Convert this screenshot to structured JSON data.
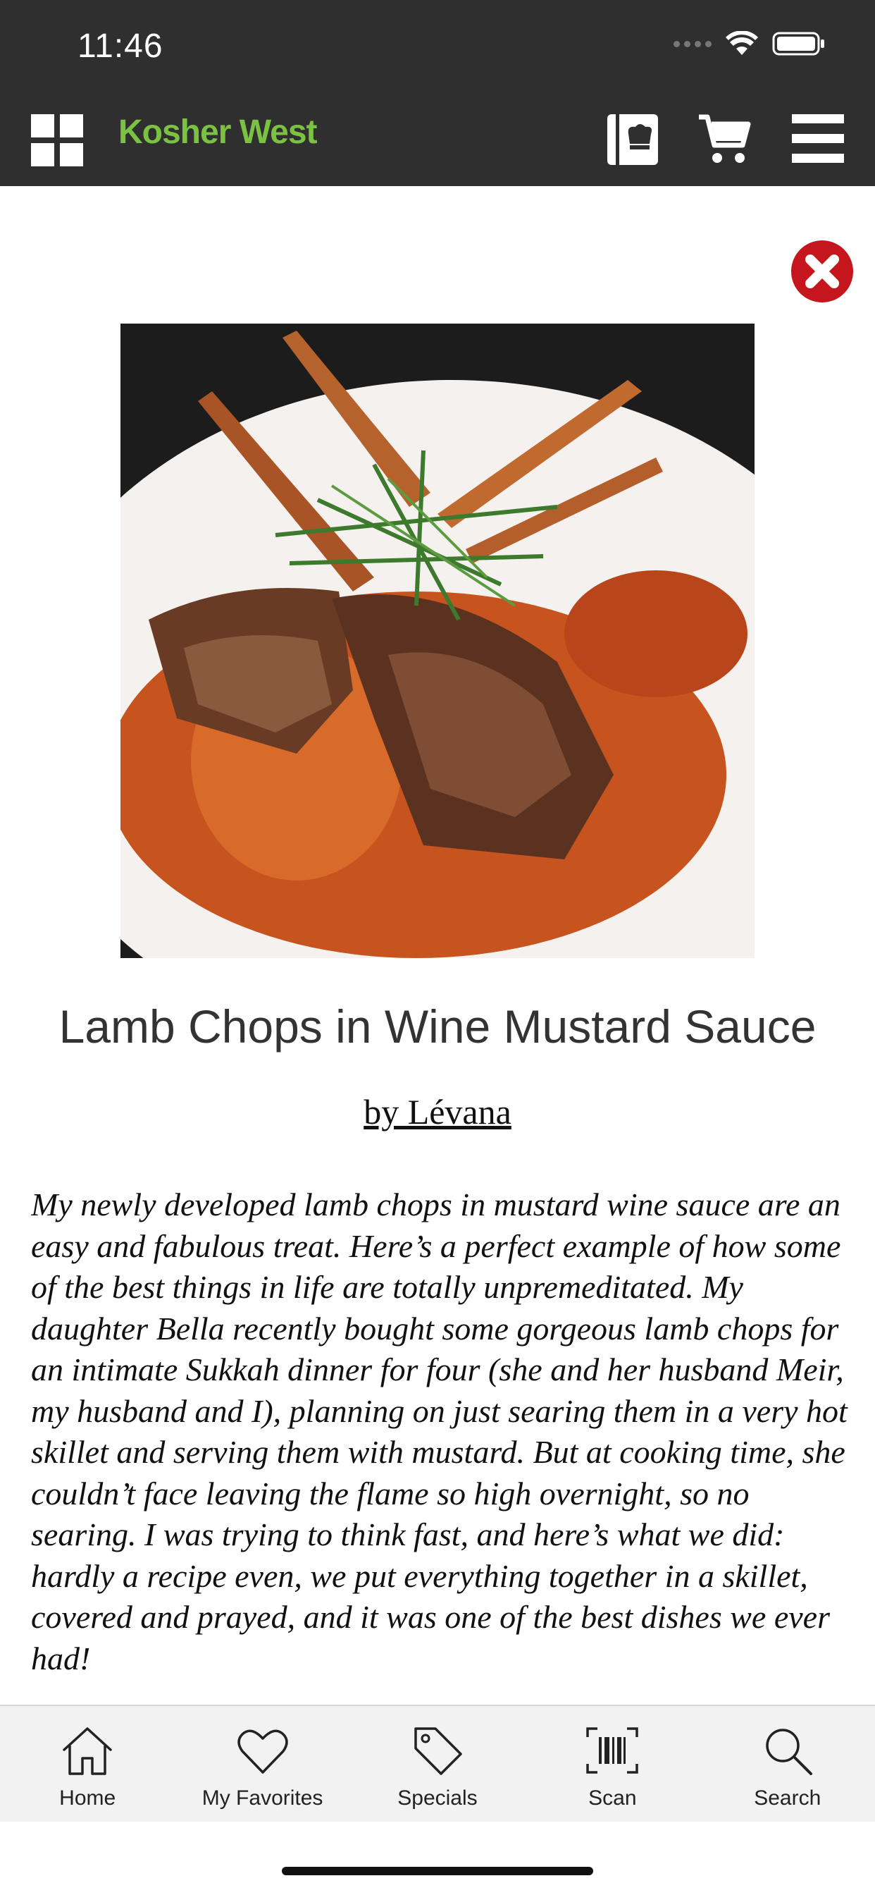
{
  "status_bar": {
    "time": "11:46"
  },
  "header": {
    "logo_text": "Kosher West"
  },
  "recipe": {
    "title": "Lamb Chops in Wine Mustard Sauce",
    "author": "by Lévana",
    "description": "My newly developed lamb chops in mustard wine sauce are an easy and fabulous treat. Here’s a perfect example of how some of the best things in life are totally unpremeditated. My daughter Bella recently bought some gorgeous lamb chops for an intimate Sukkah dinner for four (she and her husband Meir, my husband and I), planning on just searing them in a very hot skillet and serving them with mustard. But at cooking time, she couldn’t face leaving the flame so high overnight, so no searing. I was trying to think fast, and here’s what we did: hardly a recipe even, we put everything together in a skillet, covered and prayed, and it was one of the best dishes we ever had!"
  },
  "tabs": [
    {
      "label": "Home",
      "icon": "home-icon"
    },
    {
      "label": "My Favorites",
      "icon": "heart-icon"
    },
    {
      "label": "Specials",
      "icon": "tag-icon"
    },
    {
      "label": "Scan",
      "icon": "barcode-icon"
    },
    {
      "label": "Search",
      "icon": "search-icon"
    }
  ],
  "colors": {
    "header_bg": "#2f2f2f",
    "logo_green": "#7cc242",
    "close_red": "#c4161c",
    "tabbar_bg": "#f2f2f2"
  }
}
